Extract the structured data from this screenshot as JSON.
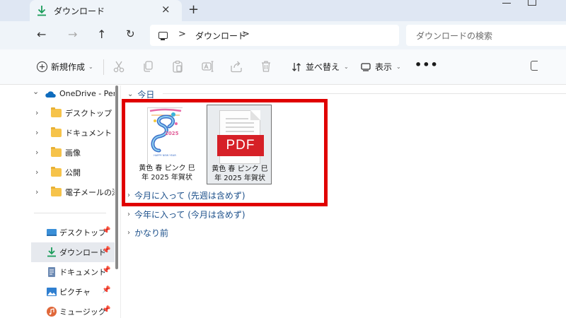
{
  "tab": {
    "title": "ダウンロード",
    "close": "×",
    "new": "+"
  },
  "nav": {
    "back": "←",
    "forward": "→",
    "up": "↑",
    "refresh": "↻"
  },
  "address": {
    "sep": ">",
    "location": "ダウンロード",
    "sep_end": ">"
  },
  "search": {
    "placeholder": "ダウンロードの検索"
  },
  "toolbar": {
    "new_label": "新規作成",
    "sort_label": "並べ替え",
    "view_label": "表示",
    "more": "•••",
    "chevron": "⌄"
  },
  "sidebar": {
    "onedrive": "OneDrive - Perso",
    "folders": [
      "デスクトップ",
      "ドキュメント",
      "画像",
      "公開",
      "電子メールの添付"
    ],
    "quick": [
      "デスクトップ",
      "ダウンロード",
      "ドキュメント",
      "ピクチャ",
      "ミュージック"
    ],
    "pin": "📌",
    "chev_down": "⌄",
    "chev_right": "›"
  },
  "groups": {
    "today": "今日",
    "this_month": "今月に入って (先週は含めず)",
    "this_year": "今年に入って (今月は含めず)",
    "long_ago": "かなり前",
    "chev_down": "⌄",
    "chev_right": "›"
  },
  "files": [
    {
      "name_line1": "黄色 春 ピンク 巳",
      "name_line2": "年 2025 年賀状",
      "thumb_year": "2025",
      "thumb_caption": "HAPPY NEW YEAR"
    },
    {
      "name_line1": "黄色 春 ピンク 巳",
      "name_line2": "年 2025 年賀状",
      "badge": "PDF"
    }
  ],
  "colors": {
    "highlight": "#e00000",
    "accent": "#1b4f8a",
    "pdf_red": "#d62027",
    "download_green": "#1a9c5a"
  }
}
